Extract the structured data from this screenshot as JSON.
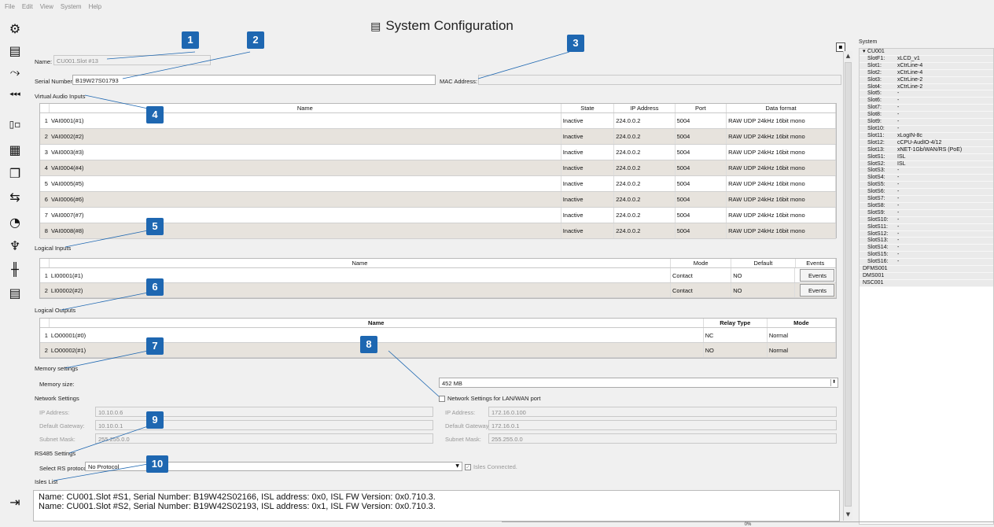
{
  "menu": [
    "File",
    "Edit",
    "View",
    "System",
    "Help"
  ],
  "toolbar_icons": [
    "gear-icon",
    "system-config-icon",
    "routing-arrow-icon",
    "audio-stream-icon",
    "io-icon",
    "matrix-icon",
    "windows-icon",
    "transfer-icon",
    "dial-icon",
    "microphone-icon",
    "mixer-icon",
    "document-icon",
    "exit-icon"
  ],
  "title": "System Configuration",
  "name_label": "Name:",
  "name_value": "CU001.Slot #13",
  "serial_label": "Serial Number:",
  "serial_value": "B19W27S01793",
  "mac_label": "MAC Address:",
  "mac_value": "",
  "vai": {
    "section": "Virtual Audio Inputs",
    "headers": [
      "Name",
      "State",
      "IP Address",
      "Port",
      "Data format"
    ],
    "rows": [
      [
        "1",
        "VAI0001(#1)",
        "Inactive",
        "224.0.0.2",
        "5004",
        "RAW UDP 24kHz 16bit mono"
      ],
      [
        "2",
        "VAI0002(#2)",
        "Inactive",
        "224.0.0.2",
        "5004",
        "RAW UDP 24kHz 16bit mono"
      ],
      [
        "3",
        "VAI0003(#3)",
        "Inactive",
        "224.0.0.2",
        "5004",
        "RAW UDP 24kHz 16bit mono"
      ],
      [
        "4",
        "VAI0004(#4)",
        "Inactive",
        "224.0.0.2",
        "5004",
        "RAW UDP 24kHz 16bit mono"
      ],
      [
        "5",
        "VAI0005(#5)",
        "Inactive",
        "224.0.0.2",
        "5004",
        "RAW UDP 24kHz 16bit mono"
      ],
      [
        "6",
        "VAI0006(#6)",
        "Inactive",
        "224.0.0.2",
        "5004",
        "RAW UDP 24kHz 16bit mono"
      ],
      [
        "7",
        "VAI0007(#7)",
        "Inactive",
        "224.0.0.2",
        "5004",
        "RAW UDP 24kHz 16bit mono"
      ],
      [
        "8",
        "VAI0008(#8)",
        "Inactive",
        "224.0.0.2",
        "5004",
        "RAW UDP 24kHz 16bit mono"
      ]
    ]
  },
  "li": {
    "section": "Logical Inputs",
    "headers": [
      "Name",
      "Mode",
      "Default",
      "Events"
    ],
    "rows": [
      [
        "1",
        "LI00001(#1)",
        "Contact",
        "NO",
        "Events"
      ],
      [
        "2",
        "LI00002(#2)",
        "Contact",
        "NO",
        "Events"
      ]
    ]
  },
  "lo": {
    "section": "Logical Outputs",
    "headers": [
      "Name",
      "Relay Type",
      "Mode"
    ],
    "rows": [
      [
        "1",
        "LO00001(#0)",
        "NC",
        "Normal"
      ],
      [
        "2",
        "LO00002(#1)",
        "NO",
        "Normal"
      ]
    ]
  },
  "memory": {
    "section": "Memory settings",
    "label": "Memory size:",
    "value": "452 MB"
  },
  "network": {
    "section": "Network Settings",
    "lanwan_label": "Network Settings for LAN/WAN port",
    "ip_label": "IP Address:",
    "gw_label": "Default Gateway:",
    "mask_label": "Subnet Mask:",
    "ip": "10.10.0.6",
    "gw": "10.10.0.1",
    "mask": "255.255.0.0",
    "ip2": "172.16.0.100",
    "gw2": "172.16.0.1",
    "mask2": "255.255.0.0"
  },
  "rs485": {
    "section": "RS485 Settings",
    "label": "Select RS protocol:",
    "value": "No Protocol",
    "isles_connected": "Isles Connected."
  },
  "isles": {
    "section": "Isles List",
    "lines": [
      "Name: CU001.Slot #S1, Serial Number: B19W42S02166, ISL address: 0x0, ISL FW Version: 0x0.710.3.",
      "Name: CU001.Slot #S2, Serial Number: B19W42S02193, ISL address: 0x1, ISL FW Version: 0x0.710.3."
    ]
  },
  "callouts": [
    "1",
    "2",
    "3",
    "4",
    "5",
    "6",
    "7",
    "8",
    "9",
    "10"
  ],
  "sidebar": {
    "header": "System",
    "items": [
      {
        "label": "CU001",
        "value": "",
        "level": 0
      },
      {
        "label": "SlotF1:",
        "value": "xLCD_v1",
        "level": 1
      },
      {
        "label": "Slot1:",
        "value": "xCtrLine-4",
        "level": 1
      },
      {
        "label": "Slot2:",
        "value": "xCtrLine-4",
        "level": 1
      },
      {
        "label": "Slot3:",
        "value": "xCtrLine-2",
        "level": 1
      },
      {
        "label": "Slot4:",
        "value": "xCtrLine-2",
        "level": 1
      },
      {
        "label": "Slot5:",
        "value": "-",
        "level": 1
      },
      {
        "label": "Slot6:",
        "value": "-",
        "level": 1
      },
      {
        "label": "Slot7:",
        "value": "-",
        "level": 1
      },
      {
        "label": "Slot8:",
        "value": "-",
        "level": 1
      },
      {
        "label": "Slot9:",
        "value": "-",
        "level": 1
      },
      {
        "label": "Slot10:",
        "value": "-",
        "level": 1
      },
      {
        "label": "Slot11:",
        "value": "xLogIN-8c",
        "level": 1
      },
      {
        "label": "Slot12:",
        "value": "cCPU-AudIO-4/12",
        "level": 1
      },
      {
        "label": "Slot13:",
        "value": "xNET-1Gb/WAN/RS (PoE)",
        "level": 1
      },
      {
        "label": "SlotS1:",
        "value": "ISL",
        "level": 1
      },
      {
        "label": "SlotS2:",
        "value": "ISL",
        "level": 1
      },
      {
        "label": "SlotS3:",
        "value": "-",
        "level": 1
      },
      {
        "label": "SlotS4:",
        "value": "-",
        "level": 1
      },
      {
        "label": "SlotS5:",
        "value": "-",
        "level": 1
      },
      {
        "label": "SlotS6:",
        "value": "-",
        "level": 1
      },
      {
        "label": "SlotS7:",
        "value": "-",
        "level": 1
      },
      {
        "label": "SlotS8:",
        "value": "-",
        "level": 1
      },
      {
        "label": "SlotS9:",
        "value": "-",
        "level": 1
      },
      {
        "label": "SlotS10:",
        "value": "-",
        "level": 1
      },
      {
        "label": "SlotS11:",
        "value": "-",
        "level": 1
      },
      {
        "label": "SlotS12:",
        "value": "-",
        "level": 1
      },
      {
        "label": "SlotS13:",
        "value": "-",
        "level": 1
      },
      {
        "label": "SlotS14:",
        "value": "-",
        "level": 1
      },
      {
        "label": "SlotS15:",
        "value": "-",
        "level": 1
      },
      {
        "label": "SlotS16:",
        "value": "-",
        "level": 1
      },
      {
        "label": "DFMS001",
        "value": "",
        "level": 0
      },
      {
        "label": "DMS001",
        "value": "",
        "level": 0
      },
      {
        "label": "NSC001",
        "value": "",
        "level": 0
      }
    ]
  },
  "progress": "0%",
  "colors": {
    "callout": "#1e67b1",
    "row_alt": "#e7e3dd"
  }
}
